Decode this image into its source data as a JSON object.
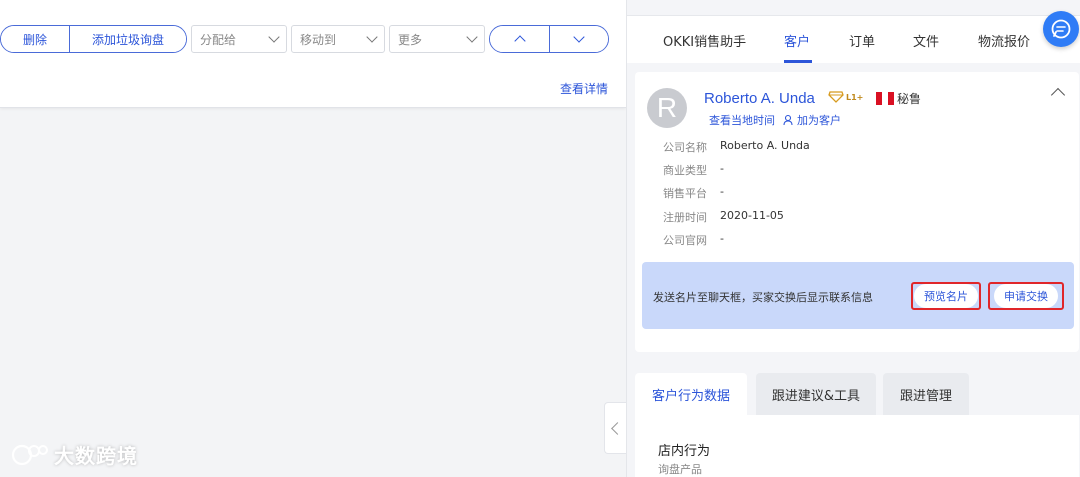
{
  "toolbar": {
    "delete_label": "删除",
    "spam_label": "添加垃圾询盘",
    "assign_placeholder": "分配给",
    "move_placeholder": "移动到",
    "more_placeholder": "更多"
  },
  "left": {
    "detail_link": "查看详情",
    "watermark": "大数跨境"
  },
  "tabs": [
    {
      "label": "OKKI销售助手"
    },
    {
      "label": "客户"
    },
    {
      "label": "订单"
    },
    {
      "label": "文件"
    },
    {
      "label": "物流报价"
    }
  ],
  "customer": {
    "avatar_letter": "R",
    "name": "Roberto A. Unda",
    "level": "L1+",
    "country": "秘鲁",
    "local_time_link": "查看当地时间",
    "add_customer_link": "加为客户",
    "fields": [
      {
        "label": "公司名称",
        "value": "Roberto A. Unda"
      },
      {
        "label": "商业类型",
        "value": "-"
      },
      {
        "label": "销售平台",
        "value": "-"
      },
      {
        "label": "注册时间",
        "value": "2020-11-05"
      },
      {
        "label": "公司官网",
        "value": "-"
      }
    ]
  },
  "notice": {
    "text": "发送名片至聊天框，买家交换后显示联系信息",
    "preview_button": "预览名片",
    "exchange_button": "申请交换"
  },
  "bottom_tabs": [
    {
      "label": "客户行为数据"
    },
    {
      "label": "跟进建议&工具"
    },
    {
      "label": "跟进管理"
    }
  ],
  "section": {
    "title": "店内行为",
    "subtitle": "询盘产品"
  },
  "colors": {
    "accent": "#2c55d9",
    "highlight_border": "#e0262a",
    "notice_bg": "#c9d8fa"
  }
}
